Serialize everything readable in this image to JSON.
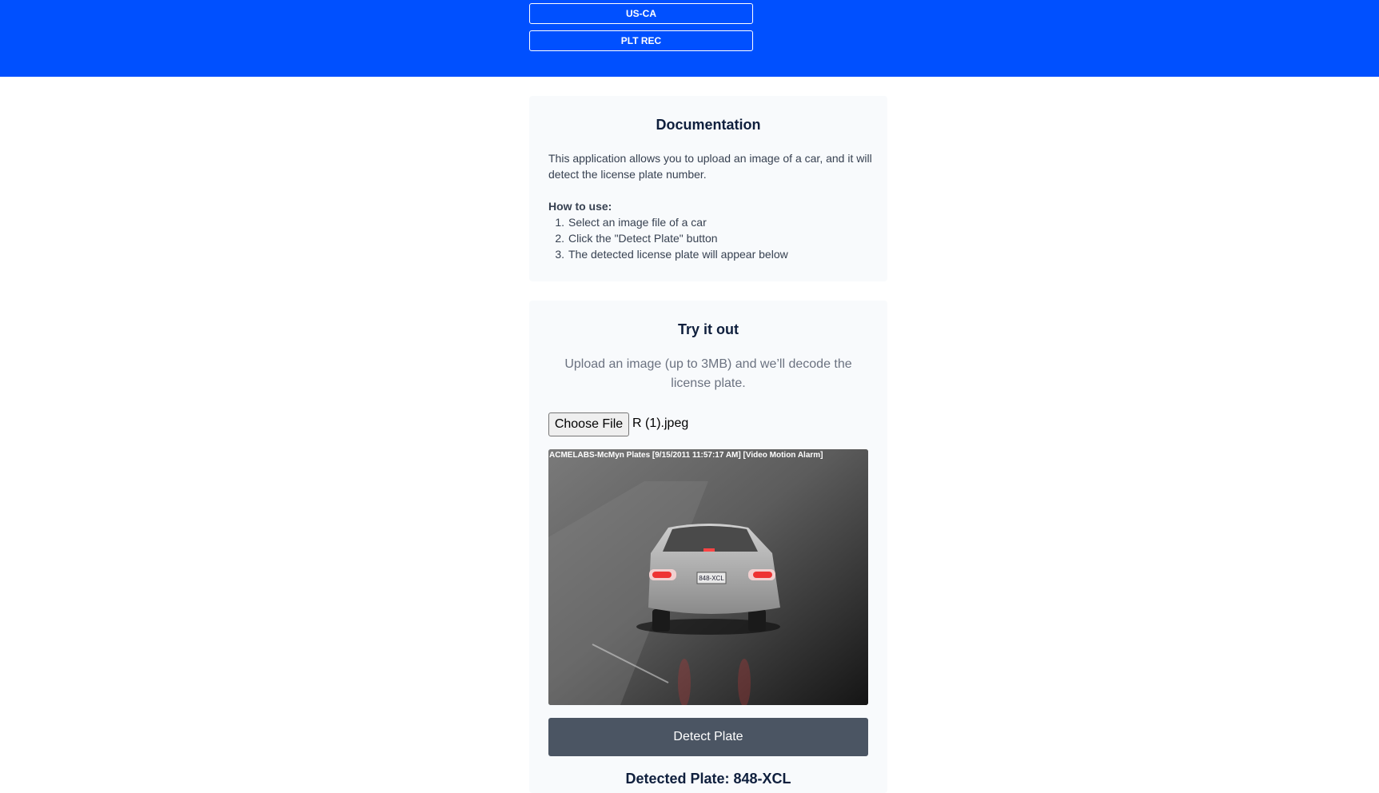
{
  "header": {
    "buttons": [
      "US-CA",
      "PLT REC"
    ],
    "background": "#0050ff"
  },
  "documentation": {
    "title": "Documentation",
    "intro": "This application allows you to upload an image of a car, and it will detect the license plate number.",
    "howto_label": "How to use:",
    "steps": [
      "Select an image file of a car",
      "Click the \"Detect Plate\" button",
      "The detected license plate will appear below"
    ]
  },
  "try": {
    "title": "Try it out",
    "subtitle": "Upload an image (up to 3MB) and we’ll decode the license plate.",
    "file_button": "Choose File",
    "file_name": "R (1).jpeg",
    "image_overlay": "ACMELABS-McMyn Plates [9/15/2011 11:57:17 AM] [Video Motion Alarm]",
    "plate_text": "848-XCL",
    "detect_button": "Detect Plate",
    "result_label": "Detected Plate: 848-XCL"
  }
}
